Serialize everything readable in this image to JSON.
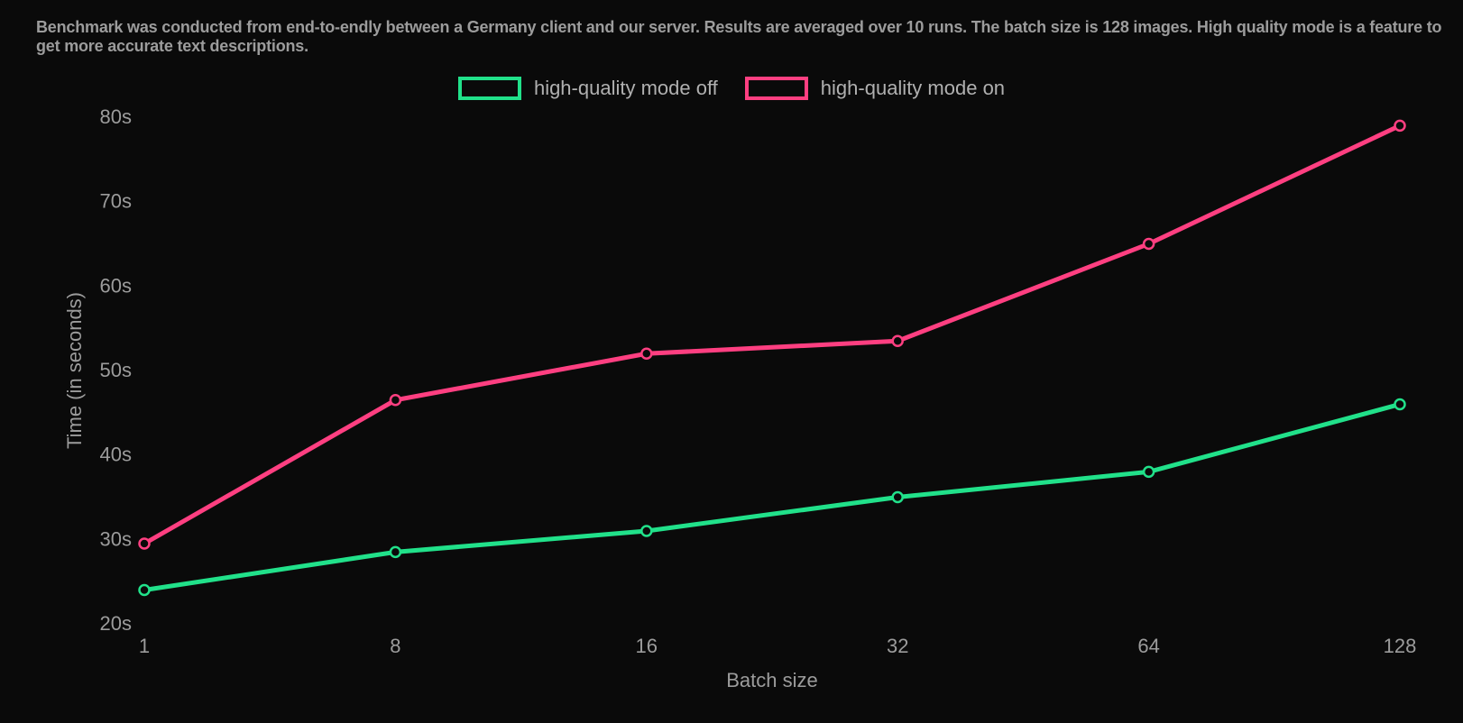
{
  "subtitle": "Benchmark was conducted from end-to-endly between a Germany client and our server. Results are averaged over 10 runs. The batch size is 128 images. High quality mode is a feature to get more accurate text descriptions.",
  "legend": {
    "series1": "high-quality mode off",
    "series2": "high-quality mode on"
  },
  "axes": {
    "xlabel": "Batch size",
    "ylabel": "Time (in seconds)"
  },
  "chart_data": {
    "type": "line",
    "xlabel": "Batch size",
    "ylabel": "Time (in seconds)",
    "ylim": [
      20,
      80
    ],
    "yticks": [
      "20s",
      "30s",
      "40s",
      "50s",
      "60s",
      "70s",
      "80s"
    ],
    "categories": [
      "1",
      "8",
      "16",
      "32",
      "64",
      "128"
    ],
    "series": [
      {
        "name": "high-quality mode off",
        "color": "#21e18a",
        "values": [
          24,
          28.5,
          31,
          35,
          38,
          46
        ]
      },
      {
        "name": "high-quality mode on",
        "color": "#ff3f81",
        "values": [
          29.5,
          46.5,
          52,
          53.5,
          65,
          79
        ]
      }
    ],
    "grid": false,
    "legend_position": "top",
    "subtitle": "Benchmark was conducted from end-to-endly between a Germany client and our server. Results are averaged over 10 runs. The batch size is 128 images. High quality mode is a feature to get more accurate text descriptions."
  }
}
